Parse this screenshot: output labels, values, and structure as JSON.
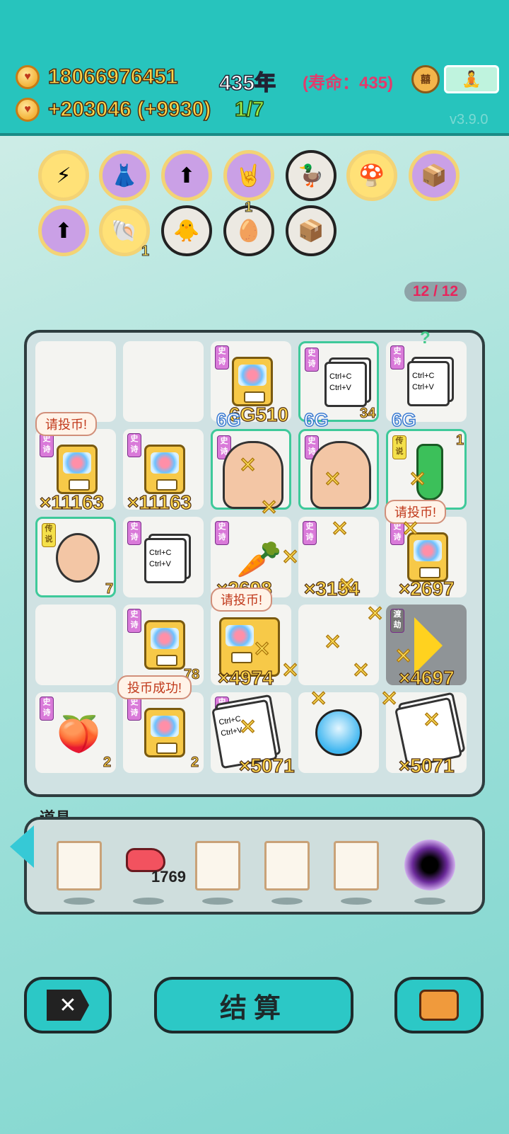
{
  "header": {
    "coins": "18066976451",
    "income": "+203046 (+9930)",
    "years": "435年",
    "lifespan": "(寿命：435)",
    "progress": "1/7",
    "version": "v3.9.0",
    "stamp_icon": "seal-icon",
    "meditate_icon": "meditate-icon"
  },
  "buffs": [
    {
      "icon": "lightning-icon",
      "count": ""
    },
    {
      "icon": "skirt-icon",
      "count": ""
    },
    {
      "icon": "capsule-up-icon",
      "count": ""
    },
    {
      "icon": "rock-hand-icon",
      "count": ""
    },
    {
      "icon": "pot-duck-icon",
      "count": ""
    },
    {
      "icon": "mushroom-cloud-icon",
      "count": ""
    },
    {
      "icon": "tissue-box-icon",
      "count": ""
    },
    {
      "icon": "capsule-up-icon",
      "count": ""
    },
    {
      "icon": "shell-icon",
      "count": "1"
    },
    {
      "icon": "chick-icon",
      "count": ""
    },
    {
      "icon": "egg-tray-icon",
      "count": "1"
    },
    {
      "icon": "tissue-box-icon",
      "count": ""
    }
  ],
  "grid_counter": "12 / 12",
  "board": {
    "tag_epic": "史诗",
    "tag_legend": "传说",
    "tag_crossing": "渡劫",
    "values": {
      "r1c3": "6G510",
      "r1c4": "34",
      "r2c1": "×11163",
      "r2c2": "×11163",
      "r2c5": "1",
      "r3c1": "7",
      "r3c3": "×2698",
      "r3c4": "×3154",
      "r3c5": "×2697",
      "r4c2": "78",
      "r4c3": "×4974",
      "r4c5": "×4697",
      "r5c1": "2",
      "r5c2": "2",
      "r5c3": "×5071",
      "r5c5": "×5071",
      "g_labels": [
        "6G",
        "6G",
        "6G"
      ],
      "question": "?"
    },
    "bubbles": {
      "insert_coin": "请投币!",
      "insert_coin2": "请投币!",
      "insert_coin3": "请投币!",
      "insert_success": "投币成功!"
    },
    "copy_text": [
      "Ctrl+C",
      "Ctrl+V"
    ]
  },
  "tools": {
    "title": "道具",
    "items": [
      {
        "icon": "printer-icon",
        "count": ""
      },
      {
        "icon": "liver-icon",
        "count": "1769"
      },
      {
        "icon": "tent-icon",
        "count": ""
      },
      {
        "icon": "copy-paste-icon",
        "count": ""
      },
      {
        "icon": "copy-paste-icon",
        "count": ""
      },
      {
        "icon": "black-hole-icon",
        "count": ""
      }
    ]
  },
  "buttons": {
    "settle": "结算",
    "close_icon": "close-icon",
    "bag_icon": "refresh-briefcase-icon"
  },
  "colors": {
    "topbar": "#27c4bd",
    "gold_text": "#ffd54a",
    "life_text": "#e23b6c",
    "progress_text": "#9ff04a",
    "epic_tag": "#d97ad9",
    "legend_tag": "#f4e04a"
  }
}
